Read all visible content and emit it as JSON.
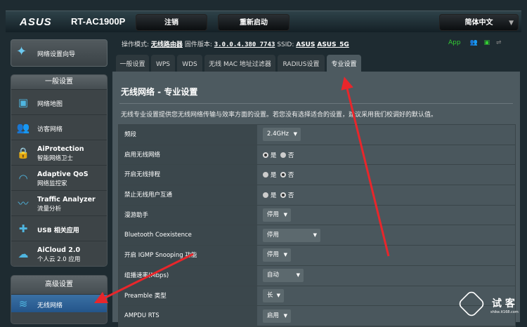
{
  "header": {
    "logo": "ASUS",
    "model": "RT-AC1900P",
    "logout": "注销",
    "reboot": "重新启动",
    "language": "简体中文"
  },
  "status": {
    "mode_label": "操作模式:",
    "mode": "无线路由器",
    "fw_label": "固件版本:",
    "fw": "3.0.0.4.380_7743",
    "ssid_label": "SSID:",
    "ssid1": "ASUS",
    "ssid2": "ASUS_5G",
    "app": "App"
  },
  "sidebar": {
    "wizard": "网络设置向导",
    "general_title": "一般设置",
    "general": [
      {
        "t1": "网络地图"
      },
      {
        "t1": "访客网络"
      },
      {
        "t1": "AiProtection",
        "t2": "智能网络卫士"
      },
      {
        "t1": "Adaptive QoS",
        "t2": "网络监控家"
      },
      {
        "t1": "Traffic Analyzer",
        "t2": "流量分析"
      },
      {
        "t1": "USB 相关应用"
      },
      {
        "t1": "AiCloud 2.0",
        "t2": "个人云 2.0 应用"
      }
    ],
    "advanced_title": "高级设置",
    "advanced": [
      {
        "t1": "无线网络"
      }
    ]
  },
  "tabs": [
    "一般设置",
    "WPS",
    "WDS",
    "无线 MAC 地址过滤器",
    "RADIUS设置",
    "专业设置"
  ],
  "main": {
    "title": "无线网络 - 专业设置",
    "desc": "无线专业设置提供您无线网络传输与效率方面的设置。若您没有选择适合的设置，建议采用我们校调好的默认值。",
    "yes": "是",
    "no": "否",
    "rows": [
      {
        "label": "频段",
        "value": "2.4GHz"
      },
      {
        "label": "启用无线网络",
        "radio": "yes"
      },
      {
        "label": "开启无线排程",
        "radio": "no"
      },
      {
        "label": "禁止无线用户互通",
        "radio": "no"
      },
      {
        "label": "漫游助手",
        "value": "停用"
      },
      {
        "label": "Bluetooth Coexistence",
        "value": "停用"
      },
      {
        "label": "开启 IGMP Snooping 功能",
        "value": "停用"
      },
      {
        "label": "组播速率(Mbps)",
        "value": "自动"
      },
      {
        "label": "Preamble 类型",
        "value": "长"
      },
      {
        "label": "AMPDU RTS",
        "value": "启用"
      }
    ]
  },
  "watermark": {
    "text": "试 客",
    "url": "shike.it168.com"
  }
}
